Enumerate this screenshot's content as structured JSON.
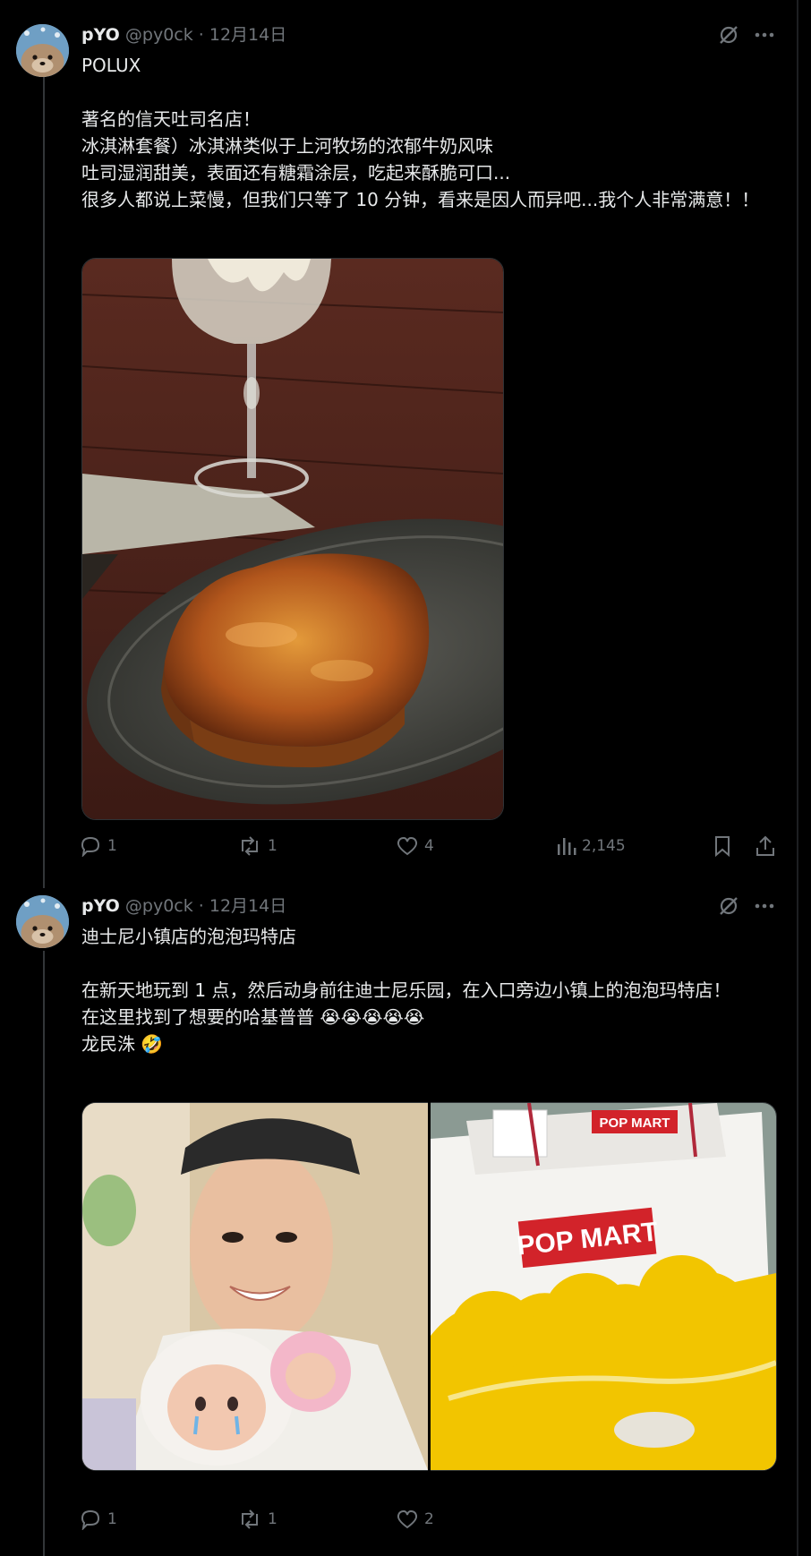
{
  "posts": [
    {
      "display_name": "pYO",
      "handle": "@py0ck",
      "separator": "·",
      "date": "12月14日",
      "lines": [
        "POLUX",
        "",
        "著名的信天吐司名店！",
        "冰淇淋套餐）冰淇淋类似于上河牧场的浓郁牛奶风味",
        "吐司湿润甜美，表面还有糖霜涂层，吃起来酥脆可口...",
        "很多人都说上菜慢，但我们只等了 10 分钟，看来是因人而异吧...我个人非常满意！！"
      ],
      "media": [
        "toast-and-ice-cream-photo"
      ],
      "replies": "1",
      "reposts": "1",
      "likes": "4",
      "views": "2,145"
    },
    {
      "display_name": "pYO",
      "handle": "@py0ck",
      "separator": "·",
      "date": "12月14日",
      "lines": [
        "迪士尼小镇店的泡泡玛特店",
        "",
        "在新天地玩到 1 点，然后动身前往迪士尼乐园，在入口旁边小镇上的泡泡玛特店！",
        "在这里找到了想要的哈基普普 😭😭😭😭😭",
        "龙民洙 🤣"
      ],
      "media": [
        "selfie-with-plush-photo",
        "pop-mart-bag-photo"
      ],
      "bag_logo": "POP MART",
      "bag_small_logo": "POP MART",
      "replies": "1",
      "reposts": "1",
      "likes": "2"
    }
  ],
  "colors": {
    "background": "#000000",
    "text": "#e7e9ea",
    "secondary": "#71767b",
    "pop_mart_red": "#d2232a",
    "bag_yellow": "#f2c500"
  }
}
